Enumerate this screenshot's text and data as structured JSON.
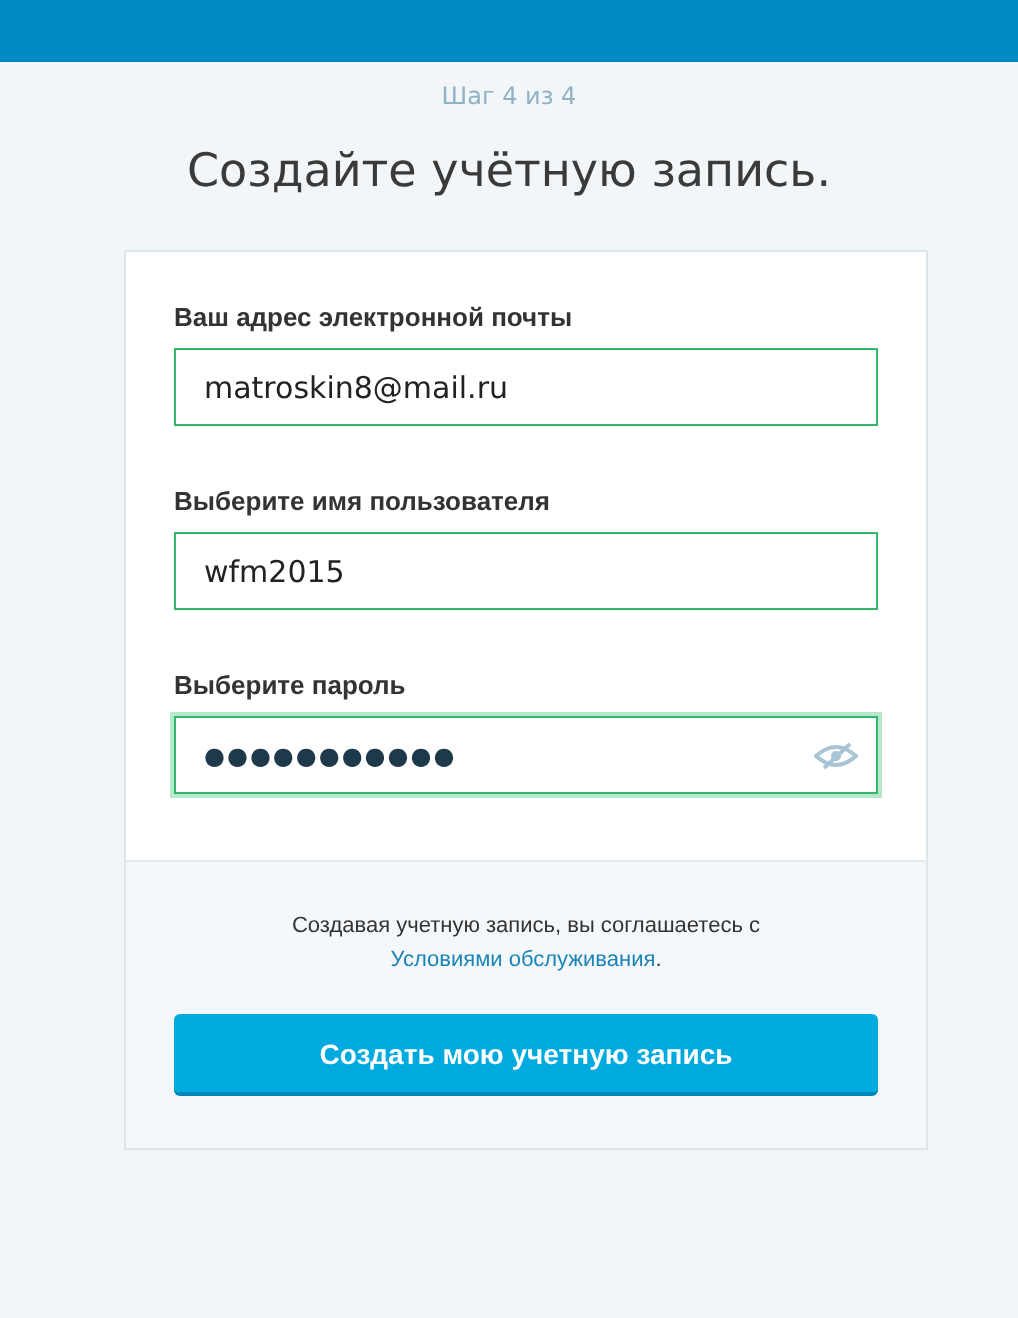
{
  "step": "Шаг 4 из 4",
  "heading": "Создайте учётную запись.",
  "fields": [
    {
      "label": "Ваш адрес электронной почты",
      "value": "matroskin8@mail.ru",
      "kind": "text",
      "focused": false
    },
    {
      "label": "Выберите имя пользователя",
      "value": "wfm2015",
      "kind": "text",
      "focused": false
    },
    {
      "label": "Выберите пароль",
      "value": "●●●●●●●●●●●",
      "kind": "password",
      "focused": true
    }
  ],
  "terms": {
    "text": "Создавая учетную запись, вы соглашаетесь с",
    "link": "Условиями обслуживания",
    "end": "."
  },
  "submit": "Создать мою учетную запись"
}
